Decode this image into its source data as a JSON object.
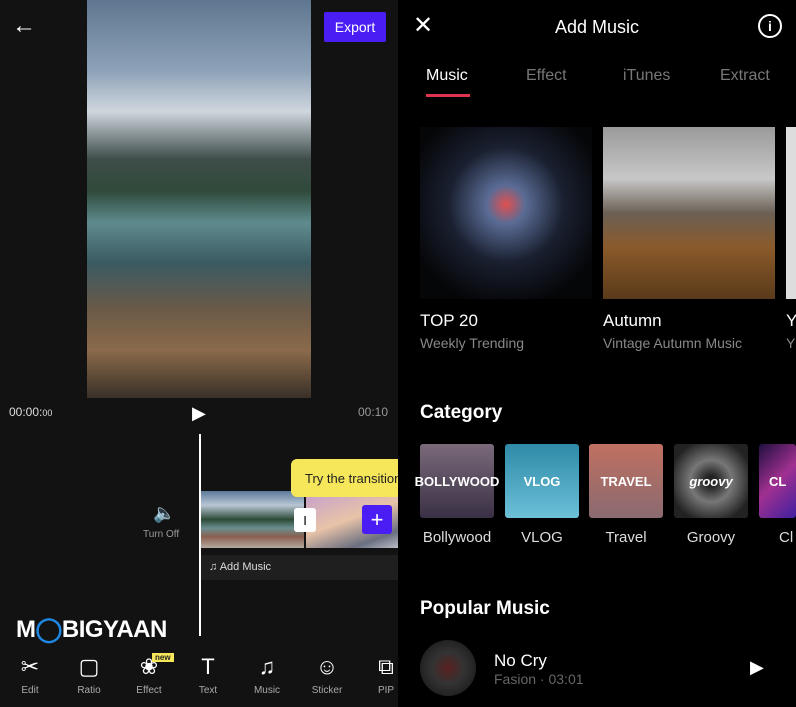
{
  "editor": {
    "export_label": "Export",
    "time_current": "00:00",
    "time_current_frames": "00",
    "time_total": "00:10",
    "tooltip": "Try the transition",
    "turn_off_label": "Turn Off",
    "add_music_label": "Add Music",
    "watermark": "MOBIGYAAN",
    "new_badge": "new",
    "tools": [
      {
        "label": "Edit",
        "icon": "scissors-icon"
      },
      {
        "label": "Ratio",
        "icon": "ratio-icon"
      },
      {
        "label": "Effect",
        "icon": "effect-icon"
      },
      {
        "label": "Text",
        "icon": "text-icon"
      },
      {
        "label": "Music",
        "icon": "music-icon"
      },
      {
        "label": "Sticker",
        "icon": "sticker-icon"
      },
      {
        "label": "PIP",
        "icon": "pip-icon"
      }
    ]
  },
  "music": {
    "title": "Add Music",
    "tabs": [
      "Music",
      "Effect",
      "iTunes",
      "Extract"
    ],
    "active_tab": "Music",
    "accent": "#e0334f",
    "featured": [
      {
        "title": "TOP 20",
        "subtitle": "Weekly Trending"
      },
      {
        "title": "Autumn",
        "subtitle": "Vintage Autumn Music"
      },
      {
        "title": "Y",
        "subtitle": "Y"
      }
    ],
    "category_heading": "Category",
    "categories": [
      {
        "label": "Bollywood",
        "art": "BOLLYWOOD"
      },
      {
        "label": "VLOG",
        "art": "VLOG"
      },
      {
        "label": "Travel",
        "art": "TRAVEL"
      },
      {
        "label": "Groovy",
        "art": "groovy"
      },
      {
        "label": "Cl",
        "art": "CL"
      }
    ],
    "popular_heading": "Popular Music",
    "popular": [
      {
        "title": "No Cry",
        "artist": "Fasion",
        "duration": "03:01"
      }
    ]
  }
}
